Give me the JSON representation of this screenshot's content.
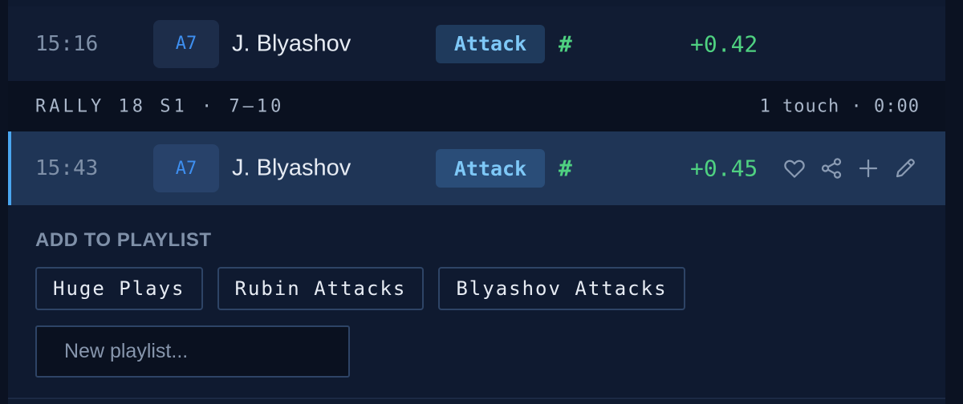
{
  "rows": [
    {
      "time": "15:16",
      "badge": "A7",
      "player": "J. Blyashov",
      "skill": "Attack",
      "grade": "#",
      "score": "+0.42"
    },
    {
      "time": "15:43",
      "badge": "A7",
      "player": "J. Blyashov",
      "skill": "Attack",
      "grade": "#",
      "score": "+0.45"
    }
  ],
  "rally": {
    "label": "RALLY 18 S1 · 7–10",
    "meta": "1 touch · 0:00"
  },
  "actions": [
    "heart-icon",
    "share-icon",
    "plus-icon",
    "pencil-icon"
  ],
  "playlist": {
    "title": "ADD TO PLAYLIST",
    "chips": [
      "Huge Plays",
      "Rubin Attacks",
      "Blyashov Attacks"
    ],
    "new_placeholder": "New playlist..."
  },
  "colors": {
    "background": "#0b1222",
    "selected_row": "#1f3556",
    "accent": "#4aa6f0",
    "positive": "#4fd181",
    "skill_text": "#7ec8f7",
    "badge_text": "#3e8ff0"
  }
}
